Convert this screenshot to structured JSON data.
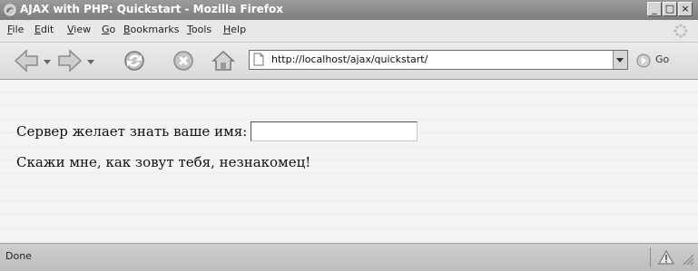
{
  "window": {
    "title": "AJAX with PHP: Quickstart - Mozilla Firefox",
    "minimize_glyph": "_",
    "maximize_glyph": "□",
    "close_glyph": "×"
  },
  "menubar": {
    "items": [
      {
        "label": "File"
      },
      {
        "label": "Edit"
      },
      {
        "label": "View"
      },
      {
        "label": "Go"
      },
      {
        "label": "Bookmarks"
      },
      {
        "label": "Tools"
      },
      {
        "label": "Help"
      }
    ]
  },
  "navbar": {
    "icons": [
      "back-icon",
      "forward-icon",
      "reload-icon",
      "stop-icon",
      "home-icon"
    ],
    "url": "http://localhost/ajax/quickstart/",
    "go_label": "Go"
  },
  "content": {
    "prompt_label": "Сервер желает знать ваше имя:",
    "name_value": "",
    "response_text": "Скажи мне, как зовут тебя, незнакомец!"
  },
  "statusbar": {
    "status_text": "Done"
  },
  "colors": {
    "titlebar": "#8a8a8a",
    "chrome": "#e2e2e2",
    "content_bg": "#f4f4f4"
  }
}
